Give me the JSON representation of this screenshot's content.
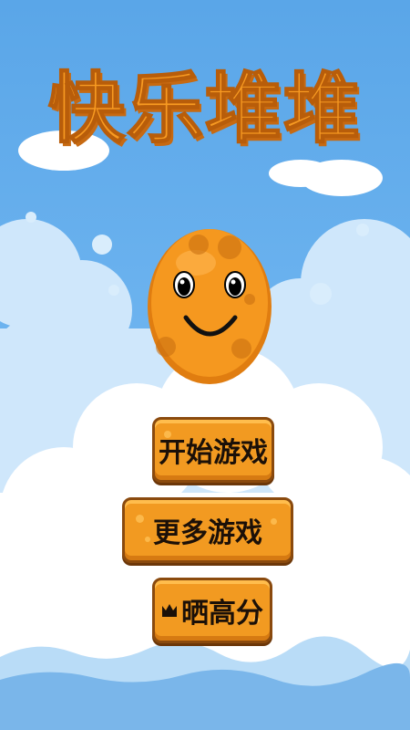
{
  "game": {
    "title": "快乐堆堆",
    "menu": {
      "start_label": "开始游戏",
      "more_label": "更多游戏",
      "score_label": "晒高分",
      "score_icon": "crown-icon"
    },
    "mascot_icon": "smiling-orange-face-icon"
  },
  "colors": {
    "sky_top": "#5aa6e8",
    "cloud": "#ffffff",
    "accent_orange": "#f29a21",
    "button_border": "#8a4a0e"
  }
}
